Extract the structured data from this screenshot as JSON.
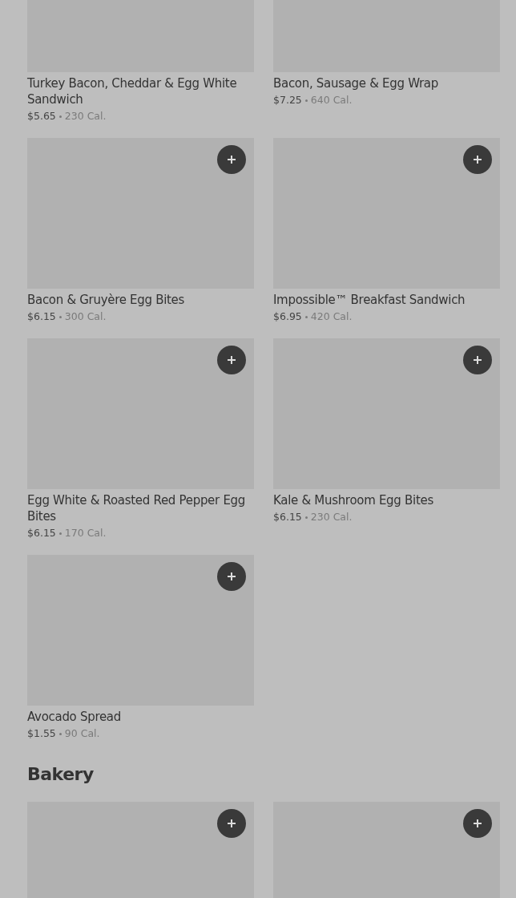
{
  "sections": [
    {
      "items": [
        {
          "name": "Turkey Bacon, Cheddar & Egg White Sandwich",
          "price": "$5.65",
          "calories": "230 Cal."
        },
        {
          "name": "Bacon, Sausage & Egg Wrap",
          "price": "$7.25",
          "calories": "640 Cal."
        },
        {
          "name": "Bacon & Gruyère Egg Bites",
          "price": "$6.15",
          "calories": "300 Cal.",
          "add_button": true
        },
        {
          "name": "Impossible™ Breakfast Sandwich",
          "price": "$6.95",
          "calories": "420 Cal.",
          "add_button": true
        },
        {
          "name": "Egg White & Roasted Red Pepper Egg Bites",
          "price": "$6.15",
          "calories": "170 Cal.",
          "add_button": true
        },
        {
          "name": "Kale & Mushroom Egg Bites",
          "price": "$6.15",
          "calories": "230 Cal.",
          "add_button": true
        },
        {
          "name": "Avocado Spread",
          "price": "$1.55",
          "calories": "90 Cal.",
          "add_button": true
        }
      ]
    },
    {
      "title": "Bakery",
      "items": [
        {
          "add_button": true
        },
        {
          "add_button": true
        }
      ]
    }
  ]
}
